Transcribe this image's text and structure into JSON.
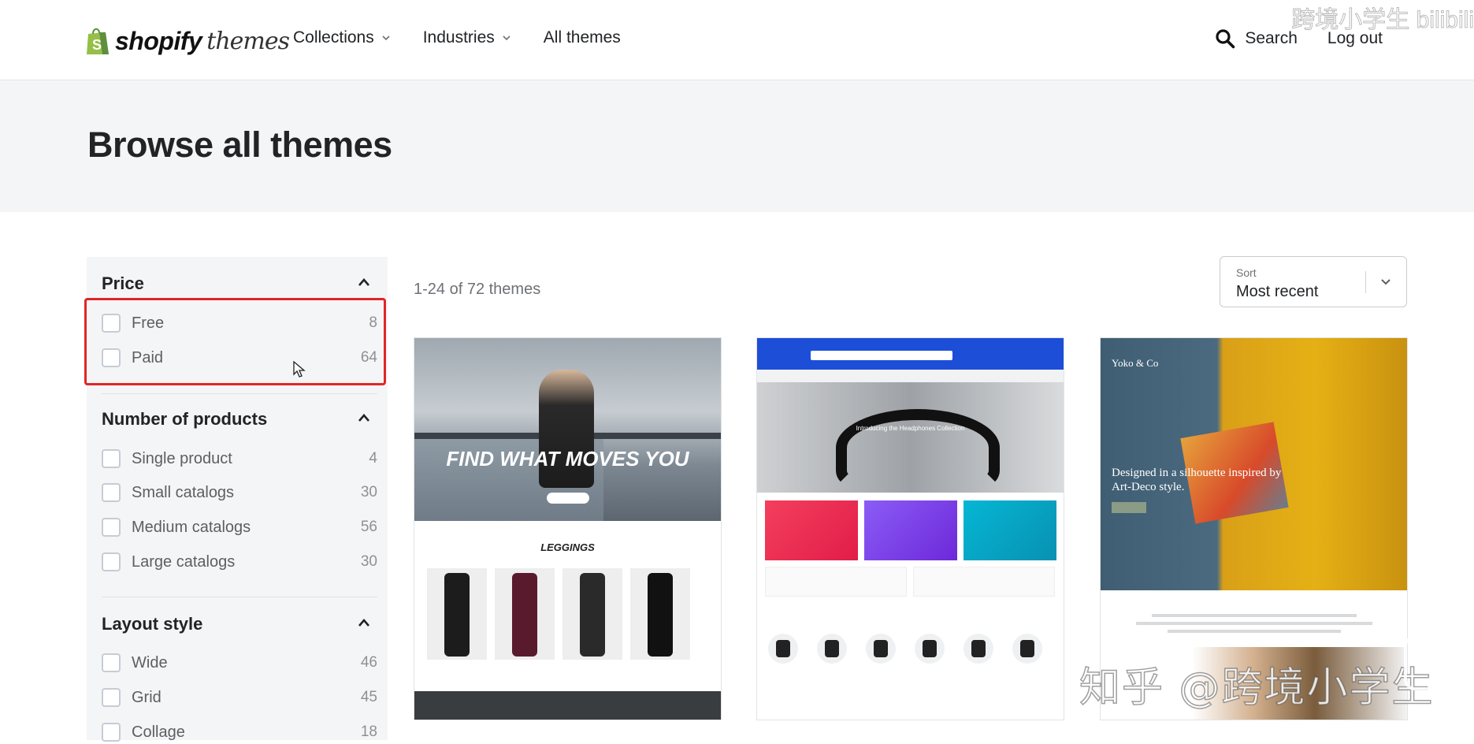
{
  "header": {
    "logo_word": "shopify",
    "logo_sub": "themes",
    "nav": [
      {
        "label": "Collections",
        "has_dropdown": true
      },
      {
        "label": "Industries",
        "has_dropdown": true
      },
      {
        "label": "All themes",
        "has_dropdown": false
      }
    ],
    "search_label": "Search",
    "logout_label": "Log out"
  },
  "hero": {
    "title": "Browse all themes"
  },
  "filters": {
    "price": {
      "title": "Price",
      "options": [
        {
          "label": "Free",
          "count": "8",
          "checked": false
        },
        {
          "label": "Paid",
          "count": "64",
          "checked": false
        }
      ]
    },
    "products": {
      "title": "Number of products",
      "options": [
        {
          "label": "Single product",
          "count": "4",
          "checked": false
        },
        {
          "label": "Small catalogs",
          "count": "30",
          "checked": false
        },
        {
          "label": "Medium catalogs",
          "count": "56",
          "checked": false
        },
        {
          "label": "Large catalogs",
          "count": "30",
          "checked": false
        }
      ]
    },
    "layout": {
      "title": "Layout style",
      "options": [
        {
          "label": "Wide",
          "count": "46",
          "checked": false
        },
        {
          "label": "Grid",
          "count": "45",
          "checked": false
        },
        {
          "label": "Collage",
          "count": "18",
          "checked": false
        }
      ]
    }
  },
  "results": {
    "count_text": "1-24 of 72 themes"
  },
  "sort": {
    "label": "Sort",
    "value": "Most recent"
  },
  "cards": [
    {
      "hero_text": "FIND WHAT MOVES YOU",
      "section_title": "LEGGINGS"
    },
    {
      "hero_text": "Introducing the Headphones Collection"
    },
    {
      "brand": "Yoko & Co",
      "headline": "Designed in a silhouette inspired by Art-Deco style."
    }
  ],
  "watermark": {
    "text": "知乎 @跨境小学生"
  },
  "colors": {
    "accent_text": "#212326",
    "panel_bg": "#f4f5f7",
    "highlight": "#e02626",
    "logo_green": "#95bf47"
  }
}
